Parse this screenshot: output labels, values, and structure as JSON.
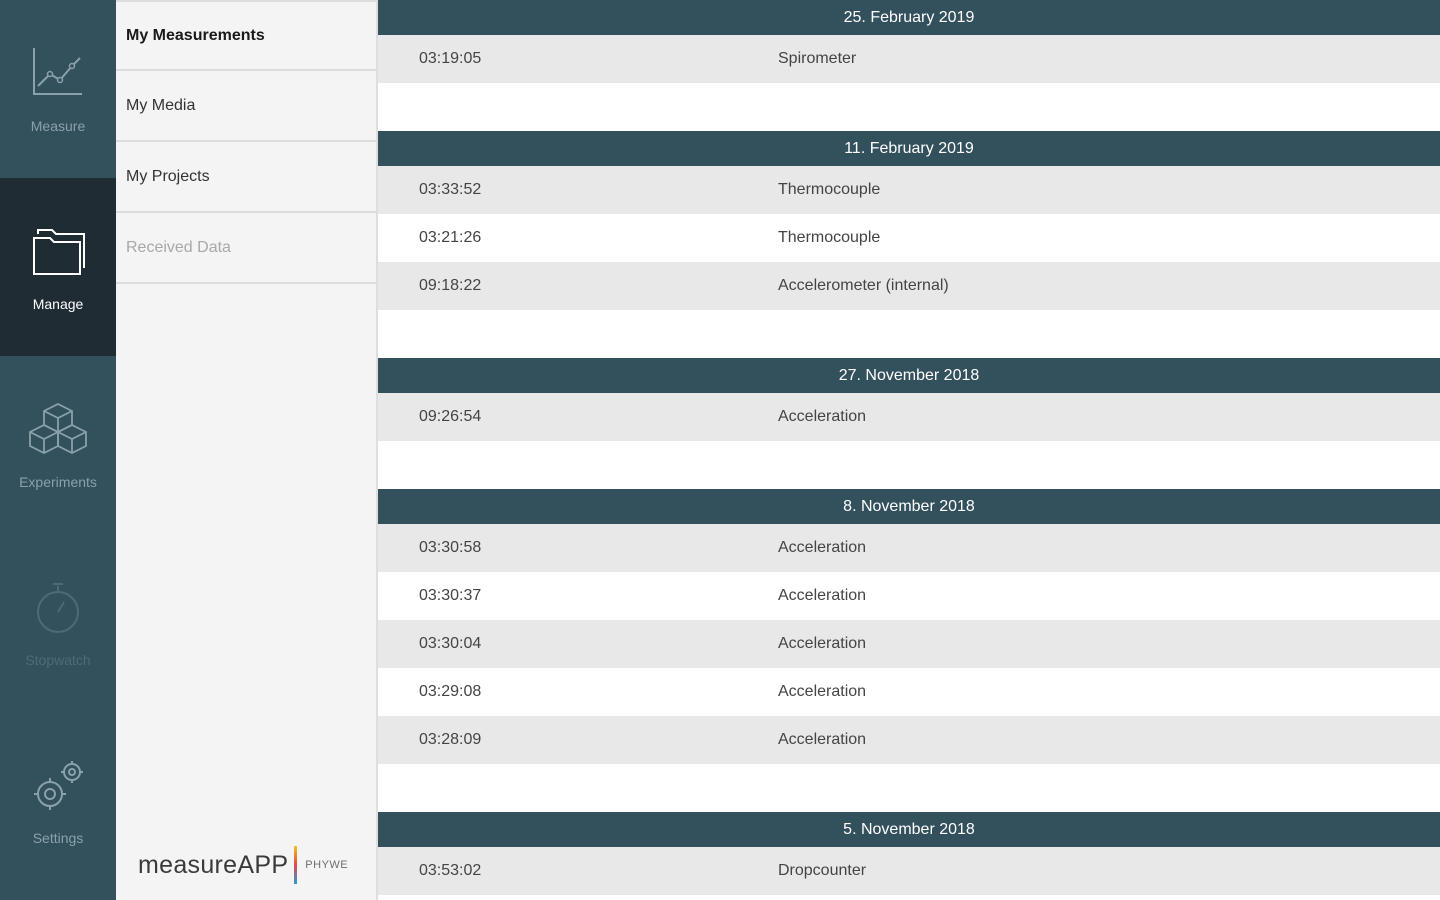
{
  "rail": {
    "items": [
      {
        "label": "Measure",
        "icon": "line-chart-icon",
        "state": "normal"
      },
      {
        "label": "Manage",
        "icon": "folder-icon",
        "state": "active"
      },
      {
        "label": "Experiments",
        "icon": "cubes-icon",
        "state": "normal"
      },
      {
        "label": "Stopwatch",
        "icon": "stopwatch-icon",
        "state": "disabled"
      },
      {
        "label": "Settings",
        "icon": "gears-icon",
        "state": "normal"
      }
    ]
  },
  "menu": {
    "items": [
      {
        "label": "My Measurements",
        "state": "selected"
      },
      {
        "label": "My Media",
        "state": "normal"
      },
      {
        "label": "My Projects",
        "state": "normal"
      },
      {
        "label": "Received Data",
        "state": "disabled"
      }
    ],
    "brand": {
      "name": "measureAPP",
      "sub": "PHYWE"
    }
  },
  "groups": [
    {
      "date": "25. February 2019",
      "rows": [
        {
          "time": "03:19:05",
          "name": "Spirometer"
        }
      ]
    },
    {
      "date": "11. February 2019",
      "rows": [
        {
          "time": "03:33:52",
          "name": "Thermocouple"
        },
        {
          "time": "03:21:26",
          "name": "Thermocouple"
        },
        {
          "time": "09:18:22",
          "name": "Accelerometer (internal)"
        }
      ]
    },
    {
      "date": "27. November 2018",
      "rows": [
        {
          "time": "09:26:54",
          "name": "Acceleration"
        }
      ]
    },
    {
      "date": "8. November 2018",
      "rows": [
        {
          "time": "03:30:58",
          "name": "Acceleration"
        },
        {
          "time": "03:30:37",
          "name": "Acceleration"
        },
        {
          "time": "03:30:04",
          "name": "Acceleration"
        },
        {
          "time": "03:29:08",
          "name": "Acceleration"
        },
        {
          "time": "03:28:09",
          "name": "Acceleration"
        }
      ]
    },
    {
      "date": "5. November 2018",
      "rows": [
        {
          "time": "03:53:02",
          "name": "Dropcounter"
        }
      ]
    }
  ],
  "colors": {
    "rail_bg": "#33505d",
    "rail_active_bg": "#1f2c33",
    "header_bg": "#33505d",
    "row_alt_bg": "#e8e8e8",
    "icon_color": "#8aa1ab"
  }
}
